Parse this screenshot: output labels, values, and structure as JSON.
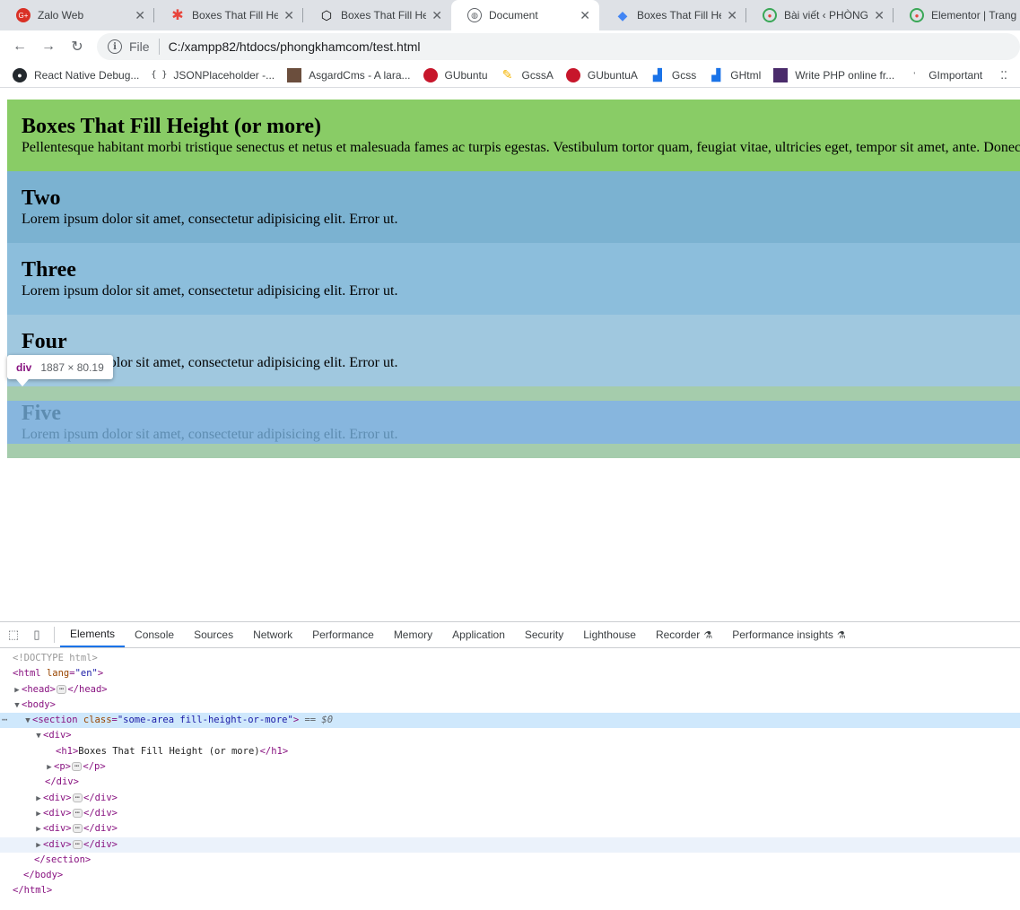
{
  "tabs": [
    {
      "title": "Zalo Web",
      "icon": "zalo-icon",
      "active": false
    },
    {
      "title": "Boxes That Fill Heig",
      "icon": "asterisk-icon",
      "active": false
    },
    {
      "title": "Boxes That Fill Heig",
      "icon": "codepen-icon",
      "active": false
    },
    {
      "title": "Document",
      "icon": "globe-icon",
      "active": true
    },
    {
      "title": "Boxes That Fill Heig",
      "icon": "layers-icon",
      "active": false
    },
    {
      "title": "Bài viết ‹ PHÒNG KI",
      "icon": "site-icon",
      "active": false
    },
    {
      "title": "Elementor | Trang c",
      "icon": "site-icon",
      "active": false
    }
  ],
  "address": {
    "scheme": "File",
    "url": "C:/xampp82/htdocs/phongkhamcom/test.html"
  },
  "bookmarks": [
    {
      "label": "React Native Debug...",
      "icon": "github-icon"
    },
    {
      "label": "JSONPlaceholder -...",
      "icon": "json-icon"
    },
    {
      "label": "AsgardCms - A lara...",
      "icon": "asgard-icon"
    },
    {
      "label": "GUbuntu",
      "icon": "ubuntu-icon"
    },
    {
      "label": "GcssA",
      "icon": "pencil-icon"
    },
    {
      "label": "GUbuntuA",
      "icon": "ubuntu-icon"
    },
    {
      "label": "Gcss",
      "icon": "chart-icon"
    },
    {
      "label": "GHtml",
      "icon": "chart-icon"
    },
    {
      "label": "Write PHP online fr...",
      "icon": "php-icon"
    },
    {
      "label": "GImportant",
      "icon": "folder-icon"
    }
  ],
  "page": {
    "boxes": [
      {
        "heading": "Boxes That Fill Height (or more)",
        "text": "Pellentesque habitant morbi tristique senectus et netus et malesuada fames ac turpis egestas. Vestibulum tortor quam, feugiat vitae, ultricies eget, tempor sit amet, ante. Donec"
      },
      {
        "heading": "Two",
        "text": "Lorem ipsum dolor sit amet, consectetur adipisicing elit. Error ut."
      },
      {
        "heading": "Three",
        "text": "Lorem ipsum dolor sit amet, consectetur adipisicing elit. Error ut."
      },
      {
        "heading": "Four",
        "text": "Lorem ipsum dolor sit amet, consectetur adipisicing elit. Error ut."
      },
      {
        "heading": "Five",
        "text": "Lorem ipsum dolor sit amet, consectetur adipisicing elit. Error ut."
      }
    ],
    "tooltip": {
      "tag": "div",
      "dims": "1887 × 80.19"
    }
  },
  "devtools": {
    "tabs": [
      {
        "label": "Elements",
        "active": true
      },
      {
        "label": "Console"
      },
      {
        "label": "Sources"
      },
      {
        "label": "Network"
      },
      {
        "label": "Performance"
      },
      {
        "label": "Memory"
      },
      {
        "label": "Application"
      },
      {
        "label": "Security"
      },
      {
        "label": "Lighthouse"
      },
      {
        "label": "Recorder",
        "experimental": true
      },
      {
        "label": "Performance insights",
        "experimental": true
      }
    ],
    "dom": {
      "doctype": "<!DOCTYPE html>",
      "html_open": "<html",
      "lang_attr": "lang",
      "lang_val": "\"en\"",
      "head_open": "<head>",
      "head_close": "</head>",
      "body_open": "<body>",
      "section_open": "<section",
      "class_attr": "class",
      "class_val": "\"some-area fill-height-or-more\"",
      "gt": ">",
      "dollar0": "== $0",
      "div_open": "<div>",
      "div_close": "</div>",
      "h1_open": "<h1>",
      "h1_text": "Boxes That Fill Height (or more)",
      "h1_close": "</h1>",
      "p_open": "<p>",
      "p_close": "</p>",
      "section_close": "</section>",
      "body_close": "</body>",
      "html_close": "</html>"
    }
  }
}
